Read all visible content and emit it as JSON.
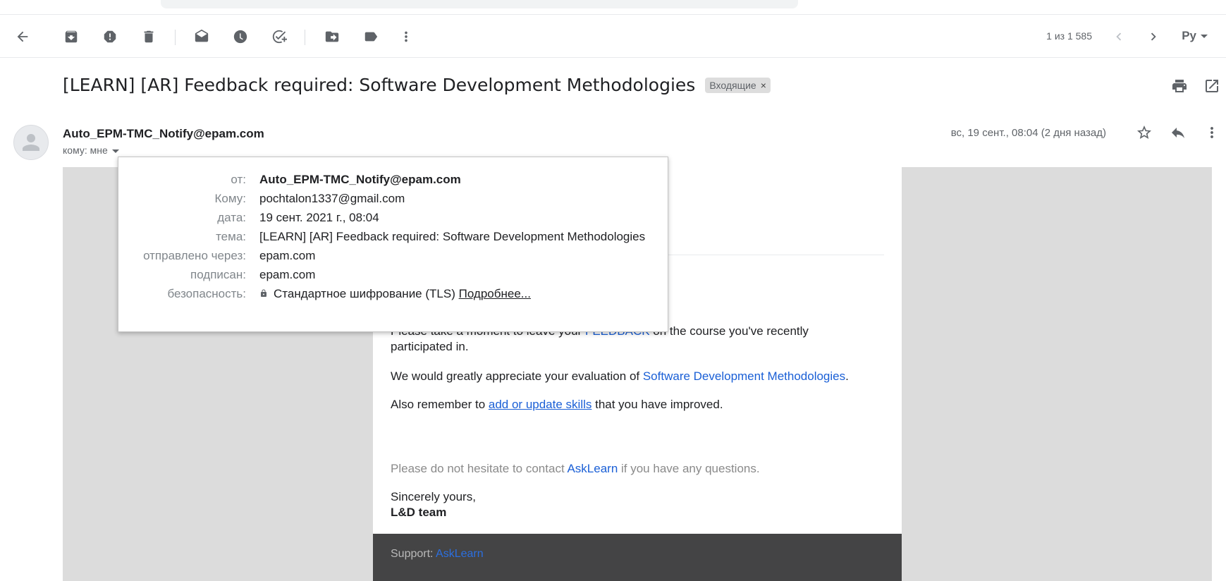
{
  "toolbar": {
    "pager_text": "1 из 1 585",
    "lang_label": "Ру"
  },
  "subject": {
    "title": "[LEARN] [AR] Feedback required: Software Development Methodologies",
    "label_chip": "Входящие",
    "label_chip_close": "×"
  },
  "message": {
    "sender": "Auto_EPM-TMC_Notify@epam.com",
    "to_me": "кому: мне",
    "date": "вс, 19 сент., 08:04 (2 дня назад)"
  },
  "details": {
    "from_label": "от:",
    "from_value": "Auto_EPM-TMC_Notify@epam.com",
    "to_label": "Кому:",
    "to_value": "pochtalon1337@gmail.com",
    "date_label": "дата:",
    "date_value": "19 сент. 2021 г., 08:04",
    "subject_label": "тема:",
    "subject_value": "[LEARN] [AR] Feedback required: Software Development Methodologies",
    "mailed_by_label": "отправлено через:",
    "mailed_by_value": "epam.com",
    "signed_by_label": "подписан:",
    "signed_by_value": "epam.com",
    "security_label": "безопасность:",
    "security_value": "Стандартное шифрование (TLS)",
    "security_more": "Подробнее..."
  },
  "body": {
    "p1_start": "Please take a moment to leave your ",
    "p1_link": "FEEDBACK",
    "p1_end": " on the course you've recently participated in.",
    "p2_start": "We would greatly appreciate your evaluation of ",
    "p2_link": "Software Development Methodologies",
    "p2_end": ".",
    "p3_start": "Also remember to ",
    "p3_link": "add or update skills",
    "p3_end": " that you have improved.",
    "p4_start": "Please do not hesitate to contact ",
    "p4_link": "AskLearn",
    "p4_end": " if you have any questions.",
    "closing": "Sincerely yours,",
    "team": "L&D team",
    "footer_label": "Support: ",
    "footer_link": "AskLearn"
  },
  "icons": [
    "back-arrow-icon",
    "archive-icon",
    "report-spam-icon",
    "delete-icon",
    "mark-unread-icon",
    "snooze-icon",
    "add-task-icon",
    "move-to-icon",
    "label-icon",
    "more-vert-icon",
    "chevron-left-icon",
    "chevron-right-icon",
    "print-icon",
    "open-new-window-icon",
    "star-icon",
    "reply-icon",
    "lock-icon",
    "avatar-placeholder-icon"
  ]
}
